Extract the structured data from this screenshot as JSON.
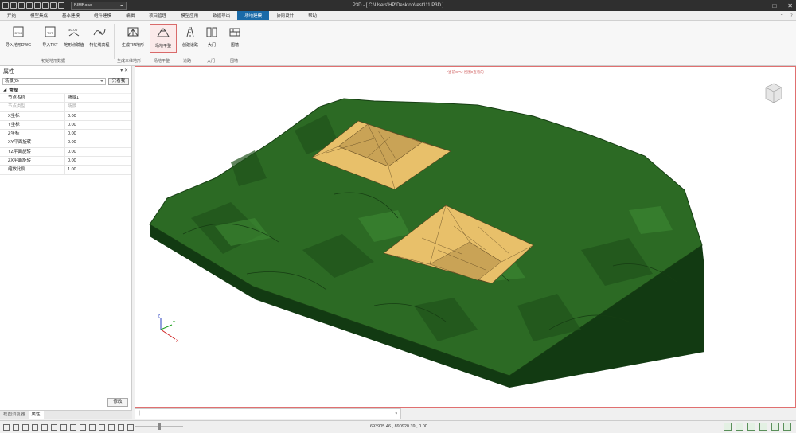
{
  "window": {
    "title": "P3D - [ C:\\Users\\HP\\Desktop\\test111.P3D ]",
    "workspace": "BIMBase"
  },
  "menu": {
    "tabs": [
      "开始",
      "模型集成",
      "基本建模",
      "组件建模",
      "编辑",
      "项目管理",
      "模型应用",
      "数据导出",
      "场地建模",
      "协同设计",
      "帮助"
    ],
    "active": "场地建模"
  },
  "ribbon": {
    "buttons": [
      {
        "label": "导入地形DWG",
        "icon": "dwg-import-icon"
      },
      {
        "label": "导入TXT",
        "icon": "txt-import-icon"
      },
      {
        "label": "地形点赋值",
        "icon": "elevation-point-icon"
      },
      {
        "label": "特征线高程",
        "icon": "feature-line-icon"
      },
      {
        "label": "生成TIN地形",
        "icon": "tin-terrain-icon"
      },
      {
        "label": "场地平整",
        "icon": "site-leveling-icon"
      },
      {
        "label": "创建道路",
        "icon": "road-icon"
      },
      {
        "label": "大门",
        "icon": "gate-icon"
      },
      {
        "label": "围墙",
        "icon": "wall-icon"
      }
    ],
    "selected": "场地平整",
    "groups": [
      "初始地形数据",
      "生成三维地形",
      "场地平整",
      "道路",
      "大门",
      "围墙"
    ]
  },
  "properties": {
    "title": "属性",
    "selector": "场景(0)",
    "button": "只看我",
    "category": "常规",
    "rows": [
      {
        "key": "节点名称",
        "value": "场景1"
      },
      {
        "key": "节点类型",
        "value": "场景",
        "dim": true
      },
      {
        "key": "X坐标",
        "value": "0.00"
      },
      {
        "key": "Y坐标",
        "value": "0.00"
      },
      {
        "key": "Z坐标",
        "value": "0.00"
      },
      {
        "key": "XY平面旋转",
        "value": "0.00"
      },
      {
        "key": "YZ平面旋转",
        "value": "0.00"
      },
      {
        "key": "ZX平面旋转",
        "value": "0.00"
      },
      {
        "key": "缩放比例",
        "value": "1.00"
      }
    ],
    "modify": "修改",
    "tabs": [
      "视图浏览器",
      "属性"
    ],
    "active_tab": "属性"
  },
  "viewport": {
    "label": "*当前CPU 视图0查看的"
  },
  "status": {
    "coords": "693905.46 , 890920.39 , 0.00"
  },
  "colors": {
    "terrain": "#2c6a24",
    "pad": "#e8c06a",
    "accent": "#1a6aa8"
  }
}
